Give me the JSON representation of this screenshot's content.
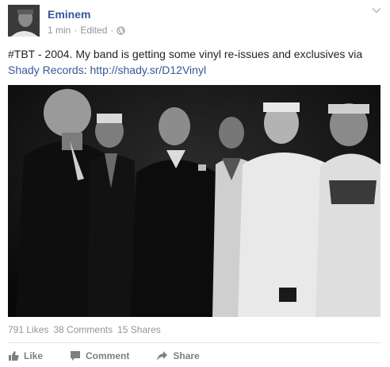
{
  "post": {
    "author": "Eminem",
    "time": "1 min",
    "edited": "Edited",
    "separator": "·",
    "text_prefix": "#TBT - 2004. My band is getting some vinyl re-issues and exclusives via ",
    "link_page": "Shady Records",
    "text_colon": ": ",
    "link_url": "http://shady.sr/D12Vinyl",
    "icons": {
      "privacy": "globe-icon",
      "menu": "chevron-down-icon"
    }
  },
  "stats": {
    "likes": "791 Likes",
    "comments": "38 Comments",
    "shares": "15 Shares"
  },
  "actions": {
    "like": "Like",
    "comment": "Comment",
    "share": "Share"
  },
  "colors": {
    "link": "#365899",
    "meta": "#90949c",
    "action": "#7f7f7f"
  }
}
